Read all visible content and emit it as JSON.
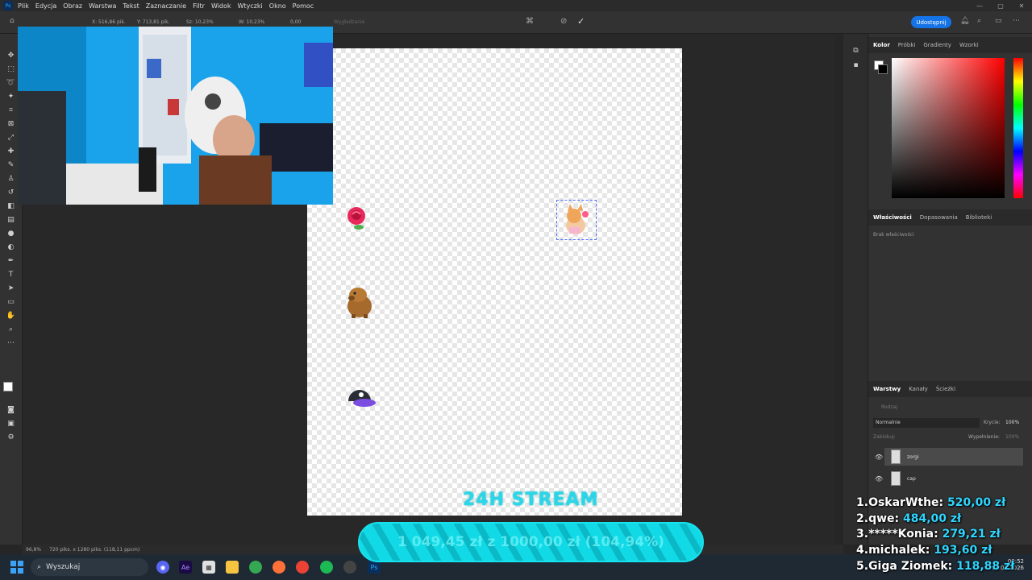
{
  "app": {
    "name": "Ps"
  },
  "menu": [
    "Plik",
    "Edycja",
    "Obraz",
    "Warstwa",
    "Tekst",
    "Zaznaczanie",
    "Filtr",
    "Widok",
    "Wtyczki",
    "Okno",
    "Pomoc"
  ],
  "options": {
    "x": "X: 516,86 pik.",
    "y": "Y: 713,81 pik.",
    "s": "Sz: 10,23%",
    "w": "W: 10,23%",
    "angle": "0,00",
    "interp": "Wygładzanie",
    "share": "Udostępnij"
  },
  "canvas": {
    "layer_names": [
      "zorgi",
      "cap"
    ],
    "stream_title": "24H STREAM",
    "progress_text": "1 049,45 zł z 1000,00 zł (104,94%)"
  },
  "right_panel": {
    "color_tabs": [
      "Kolor",
      "Próbki",
      "Gradienty",
      "Wzorki"
    ],
    "prop_tabs": [
      "Właściwości",
      "Dopasowania",
      "Biblioteki"
    ],
    "prop_empty": "Brak właściwości",
    "layer_tabs": [
      "Warstwy",
      "Kanały",
      "Ścieżki"
    ],
    "layer_search": "Rodzaj",
    "blend_mode": "Normalnie",
    "opacity_label": "Krycie:",
    "opacity_value": "100%",
    "lock_label": "Zablokuj:",
    "fill_label": "Wypełnienie:",
    "fill_value": "100%"
  },
  "status": {
    "zoom": "96,8%",
    "doc_info": "720 piks. x 1280 piks. (118,11 ppcm)"
  },
  "leaderboard": [
    {
      "rank": "1.",
      "name": "OskarWthe:",
      "amount": "520,00 zł"
    },
    {
      "rank": "2.",
      "name": "qwe:",
      "amount": "484,00 zł"
    },
    {
      "rank": "3.",
      "name": "*****Konia:",
      "amount": "279,21 zł"
    },
    {
      "rank": "4.",
      "name": "michalek:",
      "amount": "193,60 zł"
    },
    {
      "rank": "5.",
      "name": "Giga Ziomek:",
      "amount": "118,88 zł"
    }
  ],
  "taskbar": {
    "search": "Wyszukaj",
    "time": "00:52",
    "date": "19.01.2026"
  }
}
